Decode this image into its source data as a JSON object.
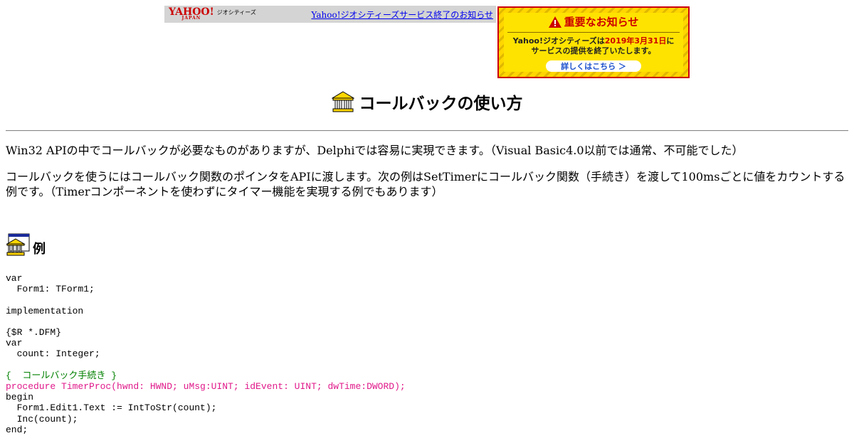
{
  "banner": {
    "brand": "YAHOO!",
    "brand_sub": "JAPAN",
    "service": "ジオシティーズ",
    "notice_link": "Yahoo!ジオシティーズサービス終了のお知らせ"
  },
  "alert": {
    "title": "重要なお知らせ",
    "msg_prefix": "Yahoo!ジオシティーズは",
    "msg_date": "2019年3月31日",
    "msg_suffix": "に",
    "msg_line2": "サービスの提供を終了いたします。",
    "button": "詳しくはこちら ＞",
    "colors": {
      "accent": "#cc0000",
      "stripe": "#ffd600"
    }
  },
  "page": {
    "title": "コールバックの使い方",
    "para1": "Win32 APIの中でコールバックが必要なものがありますが、Delphiでは容易に実現できます。（Visual Basic4.0以前では通常、不可能でした）",
    "para2": "コールバックを使うにはコールバック関数のポインタをAPIに渡します。次の例はSetTimerにコールバック関数（手続き）を渡して100msごとに値をカウントする例です。（Timerコンポーネントを使わずにタイマー機能を実現する例でもあります）",
    "section_title": "例"
  },
  "code": {
    "block1": "var\n  Form1: TForm1;\n\nimplementation\n\n{$R *.DFM}\nvar\n  count: Integer;\n\n",
    "comment": "{  コールバック手続き }",
    "proc": "procedure TimerProc(hwnd: HWND; uMsg:UINT; idEvent: UINT; dwTime:DWORD);",
    "block2": "begin\n  Form1.Edit1.Text := IntToStr(count);\n  Inc(count);\nend;"
  }
}
